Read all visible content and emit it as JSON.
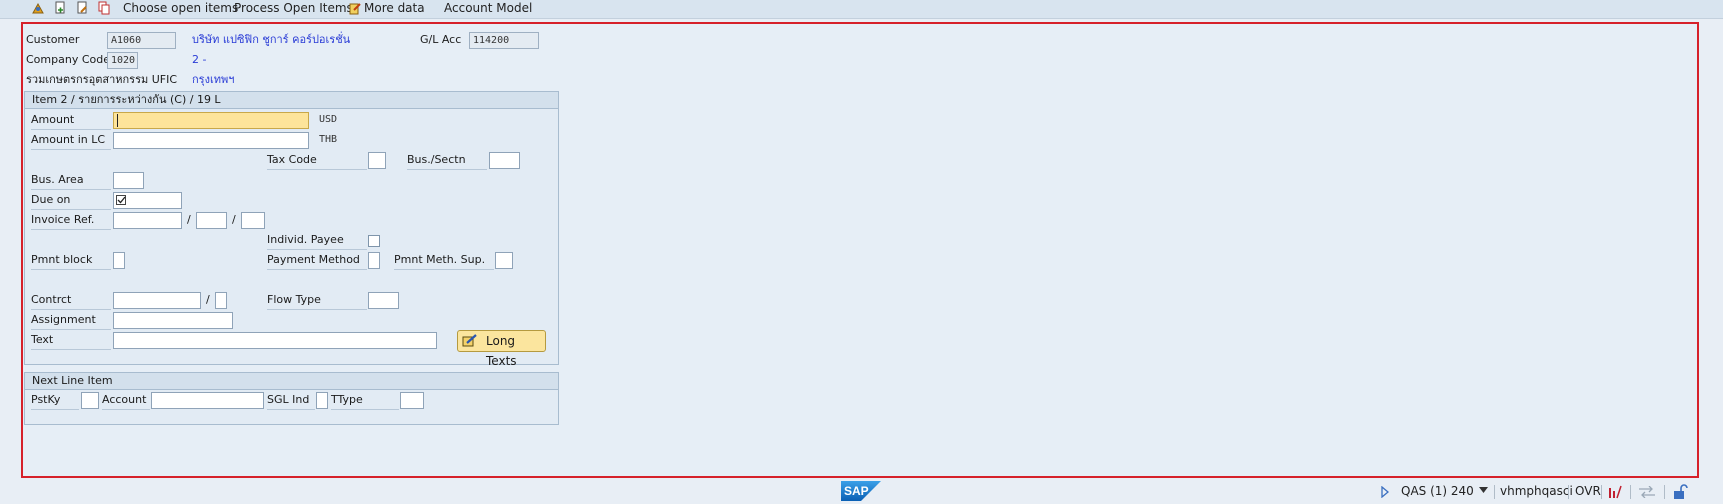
{
  "toolbar": {
    "choose_open_items": "Choose open items",
    "process_open_items": "Process Open Items",
    "more_data": "More data",
    "account_model": "Account Model"
  },
  "header": {
    "customer_label": "Customer",
    "customer_value": "A1060",
    "customer_name": "บริษัท แปซิฟิก ชูการ์ คอร์ปอเรชั่น",
    "gl_acc_label": "G/L Acc",
    "gl_acc_value": "114200",
    "company_code_label": "Company Code",
    "company_code_value": "1020",
    "company_suffix": "2 -",
    "company_name": "รวมเกษตรกรอุตสาหกรรม UFIC",
    "city": "กรุงเทพฯ"
  },
  "item_group": {
    "title": "Item 2 / รายการระหว่างกัน (C) / 19 L",
    "amount_label": "Amount",
    "amount_value": "",
    "amount_unit": "USD",
    "amount_lc_label": "Amount in LC",
    "amount_lc_value": "",
    "amount_lc_unit": "THB",
    "tax_code_label": "Tax Code",
    "bus_sectn_label": "Bus./Sectn",
    "bus_area_label": "Bus. Area",
    "due_on_label": "Due on",
    "invoice_ref_label": "Invoice Ref.",
    "slash": "/",
    "individ_payee_label": "Individ. Payee",
    "pmnt_block_label": "Pmnt block",
    "payment_method_label": "Payment Method",
    "pmnt_meth_sup_label": "Pmnt Meth. Sup.",
    "contrct_label": "Contrct",
    "flow_type_label": "Flow Type",
    "assignment_label": "Assignment",
    "text_label": "Text",
    "long_texts_button": "Long Texts"
  },
  "next_line": {
    "title": "Next Line Item",
    "pstky_label": "PstKy",
    "account_label": "Account",
    "sgl_ind_label": "SGL Ind",
    "ttype_label": "TType"
  },
  "statusbar": {
    "system": "QAS (1) 240",
    "server": "vhmphqasci",
    "mode": "OVR",
    "logo": "SAP"
  }
}
